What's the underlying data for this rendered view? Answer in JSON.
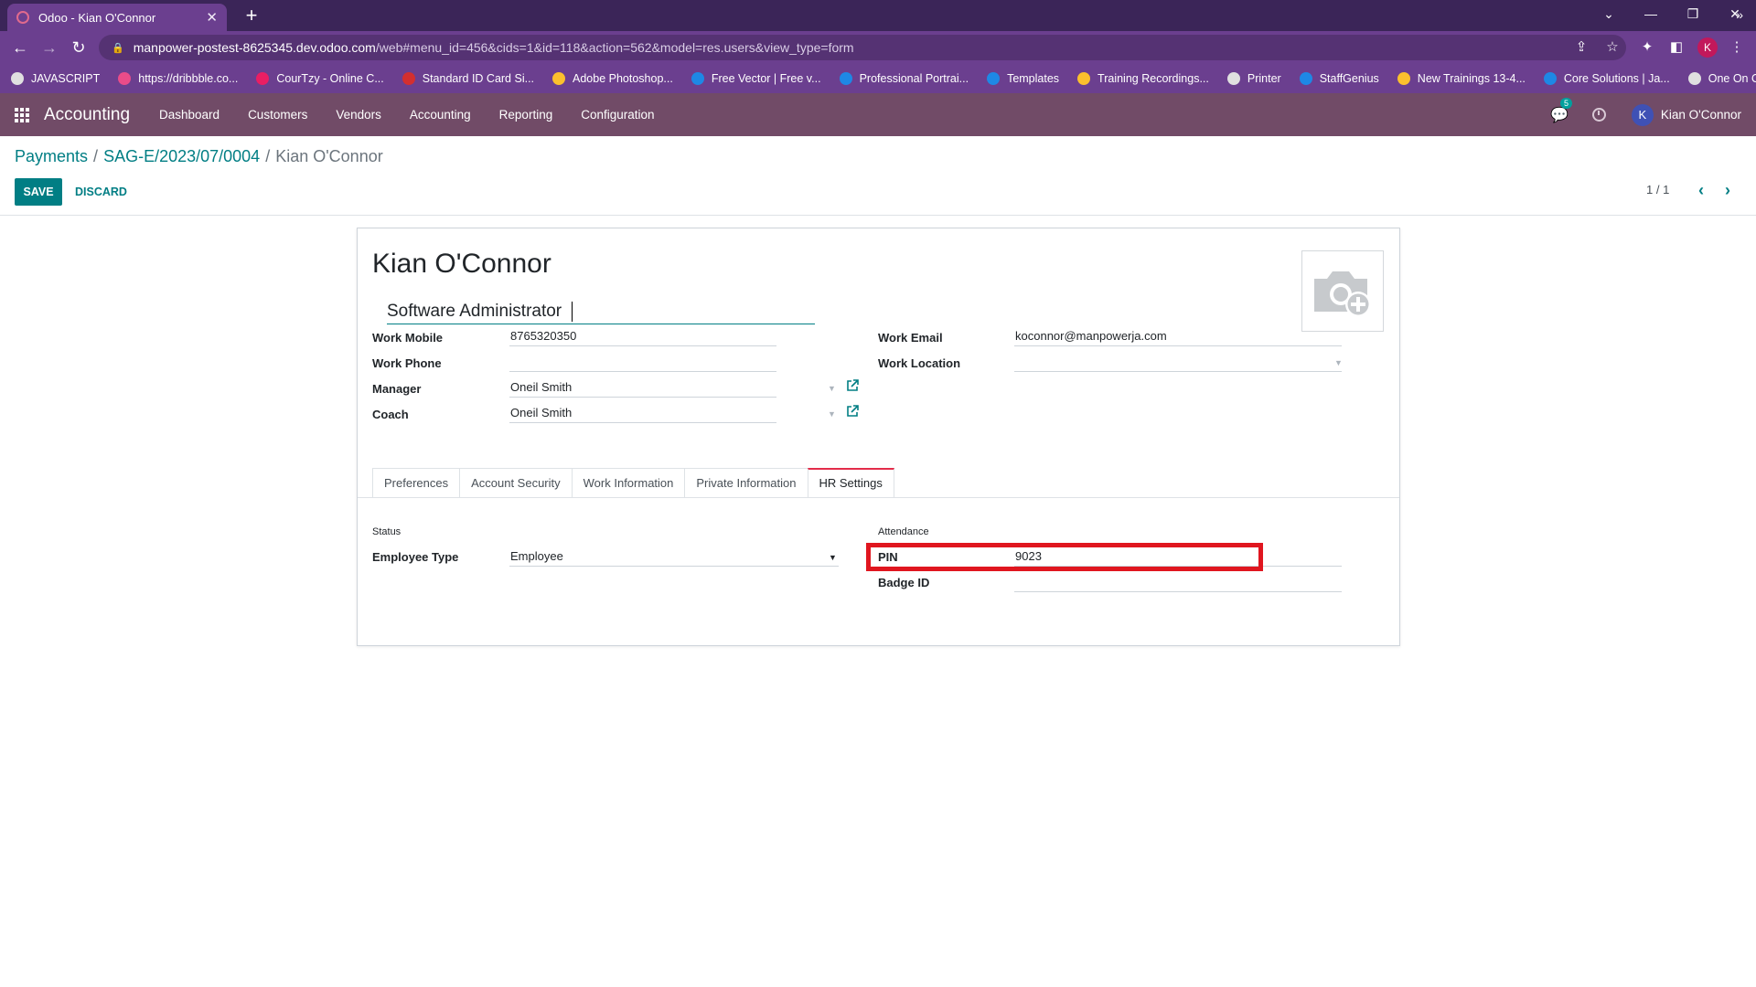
{
  "browser": {
    "tab_title": "Odoo - Kian O'Connor",
    "tab_close": "✕",
    "new_tab": "+",
    "url_host": "manpower-postest-8625345.dev.odoo.com",
    "url_path": "/web#menu_id=456&cids=1&id=118&action=562&model=res.users&view_type=form",
    "profile_initial": "K",
    "bookmarks": [
      {
        "label": "JAVASCRIPT",
        "color": "#e0e0e0"
      },
      {
        "label": "https://dribbble.co...",
        "color": "#ea4c89"
      },
      {
        "label": "CourTzy - Online C...",
        "color": "#e91e63"
      },
      {
        "label": "Standard ID Card Si...",
        "color": "#d32f2f"
      },
      {
        "label": "Adobe Photoshop...",
        "color": "#fbc02d"
      },
      {
        "label": "Free Vector | Free v...",
        "color": "#1e88e5"
      },
      {
        "label": "Professional Portrai...",
        "color": "#1e88e5"
      },
      {
        "label": "Templates",
        "color": "#1e88e5"
      },
      {
        "label": "Training Recordings...",
        "color": "#fbc02d"
      },
      {
        "label": "Printer",
        "color": "#e0e0e0"
      },
      {
        "label": "StaffGenius",
        "color": "#1e88e5"
      },
      {
        "label": "New Trainings 13-4...",
        "color": "#fbc02d"
      },
      {
        "label": "Core Solutions | Ja...",
        "color": "#1e88e5"
      },
      {
        "label": "One On One LMS O...",
        "color": "#e0e0e0"
      }
    ],
    "bookmarks_more": "»"
  },
  "navbar": {
    "app_name": "Accounting",
    "menus": [
      "Dashboard",
      "Customers",
      "Vendors",
      "Accounting",
      "Reporting",
      "Configuration"
    ],
    "chat_count": "5",
    "user_initial": "K",
    "user_name": "Kian O'Connor"
  },
  "control_panel": {
    "breadcrumb": [
      "Payments",
      "SAG-E/2023/07/0004",
      "Kian O'Connor"
    ],
    "separator": "/",
    "save_label": "SAVE",
    "discard_label": "DISCARD",
    "pager_value": "1 / 1"
  },
  "form": {
    "name": "Kian O'Connor",
    "job_title": "Software Administrator",
    "work_mobile": {
      "label": "Work Mobile",
      "value": "8765320350"
    },
    "work_phone": {
      "label": "Work Phone",
      "value": ""
    },
    "manager": {
      "label": "Manager",
      "value": "Oneil Smith"
    },
    "coach": {
      "label": "Coach",
      "value": "Oneil Smith"
    },
    "work_email": {
      "label": "Work Email",
      "value": "koconnor@manpowerja.com"
    },
    "work_location": {
      "label": "Work Location",
      "value": ""
    },
    "tabs": [
      "Preferences",
      "Account Security",
      "Work Information",
      "Private Information",
      "HR Settings"
    ],
    "active_tab": "HR Settings",
    "status_group": "Status",
    "employee_type": {
      "label": "Employee Type",
      "value": "Employee"
    },
    "attendance_group": "Attendance",
    "pin": {
      "label": "PIN",
      "value": "9023"
    },
    "badge_id": {
      "label": "Badge ID",
      "value": ""
    }
  },
  "colors": {
    "browser_frame": "#3b2558",
    "odoo_navbar": "#714b67",
    "primary_teal": "#017e84",
    "highlight_red": "#e0161f"
  }
}
